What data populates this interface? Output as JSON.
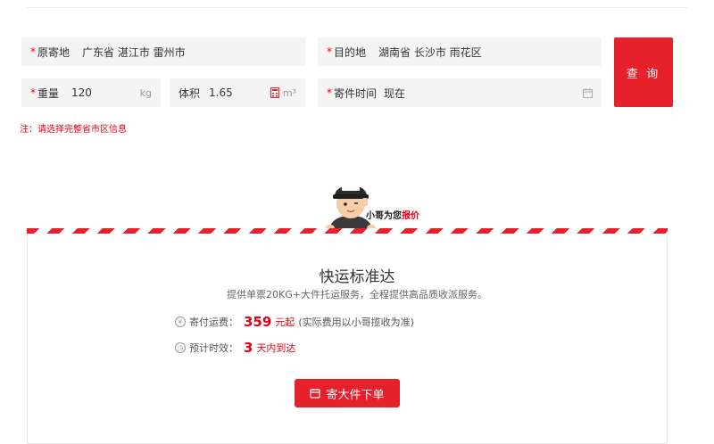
{
  "form": {
    "origin": {
      "required": "*",
      "label": "原寄地",
      "value": "广东省 湛江市 雷州市"
    },
    "destination": {
      "required": "*",
      "label": "目的地",
      "value": "湖南省 长沙市 雨花区"
    },
    "weight": {
      "required": "*",
      "label": "重量",
      "value": "120",
      "unit": "kg"
    },
    "volume": {
      "label": "体积",
      "value": "1.65",
      "unit": "m³"
    },
    "send_time": {
      "required": "*",
      "label": "寄件时间",
      "value": "现在"
    },
    "query_button": "查 询",
    "note": "注：请选择完整省市区信息"
  },
  "mascot": {
    "text_prefix": "小哥为您",
    "text_highlight": "报价",
    "brand_on_cap": "顺丰"
  },
  "result": {
    "title": "快运标准达",
    "subtitle": "提供单票20KG+大件托运服务，全程提供高品质收派服务。",
    "fee_label": "寄付运费：",
    "fee_value": "359",
    "fee_unit": "元起",
    "fee_note": "(实际费用以小哥揽收为准)",
    "eta_label": "预计时效：",
    "eta_value": "3",
    "eta_unit": "天内到达",
    "cta_label": "寄大件下单"
  },
  "colors": {
    "accent": "#e6212c",
    "field_bg": "#f4f4f4"
  }
}
